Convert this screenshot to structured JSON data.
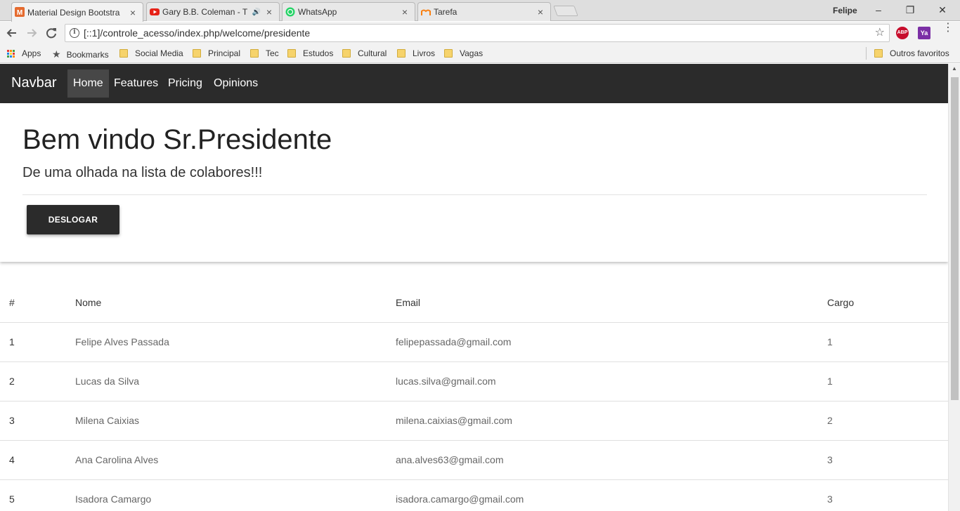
{
  "browser": {
    "tabs": [
      {
        "title": "Material Design Bootstra",
        "active": true,
        "favicon": "mdb-icon"
      },
      {
        "title": "Gary B.B. Coleman - T",
        "active": false,
        "favicon": "youtube-icon",
        "sound": "🔊"
      },
      {
        "title": "WhatsApp",
        "active": false,
        "favicon": "whatsapp-icon"
      },
      {
        "title": "Tarefa",
        "active": false,
        "favicon": "moodle-icon"
      }
    ],
    "close_glyph": "×",
    "user": "Felipe",
    "window_controls": {
      "minimize": "–",
      "restore": "❐",
      "close": "✕"
    },
    "url": "[::1]/controle_acesso/index.php/welcome/presidente",
    "extensions": {
      "abp": "ABP",
      "ya": "Ya"
    },
    "bookmarks": [
      {
        "label": "Apps",
        "icon": "apps-grid-icon"
      },
      {
        "label": "Bookmarks",
        "icon": "star-icon"
      },
      {
        "label": "Social Media",
        "icon": "folder-icon"
      },
      {
        "label": "Principal",
        "icon": "folder-icon"
      },
      {
        "label": "Tec",
        "icon": "folder-icon"
      },
      {
        "label": "Estudos",
        "icon": "folder-icon"
      },
      {
        "label": "Cultural",
        "icon": "folder-icon"
      },
      {
        "label": "Livros",
        "icon": "folder-icon"
      },
      {
        "label": "Vagas",
        "icon": "folder-icon"
      }
    ],
    "other_bookmarks": "Outros favoritos",
    "colors": {
      "youtube": "#e62117",
      "whatsapp": "#25d366",
      "mdb": "#e56b2f",
      "abp": "#c70d2c",
      "ya": "#7b2fa5"
    }
  },
  "page": {
    "navbar": {
      "brand": "Navbar",
      "links": [
        "Home",
        "Features",
        "Pricing",
        "Opinions"
      ],
      "active": "Home"
    },
    "jumbotron": {
      "title": "Bem vindo Sr.Presidente",
      "lead": "De uma olhada na lista de colabores!!!",
      "button": "DESLOGAR"
    },
    "table": {
      "headers": [
        "#",
        "Nome",
        "Email",
        "Cargo"
      ],
      "rows": [
        [
          "1",
          "Felipe Alves Passada",
          "felipepassada@gmail.com",
          "1"
        ],
        [
          "2",
          "Lucas da Silva",
          "lucas.silva@gmail.com",
          "1"
        ],
        [
          "3",
          "Milena Caixias",
          "milena.caixias@gmail.com",
          "2"
        ],
        [
          "4",
          "Ana Carolina Alves",
          "ana.alves63@gmail.com",
          "3"
        ],
        [
          "5",
          "Isadora Camargo",
          "isadora.camargo@gmail.com",
          "3"
        ]
      ]
    }
  }
}
